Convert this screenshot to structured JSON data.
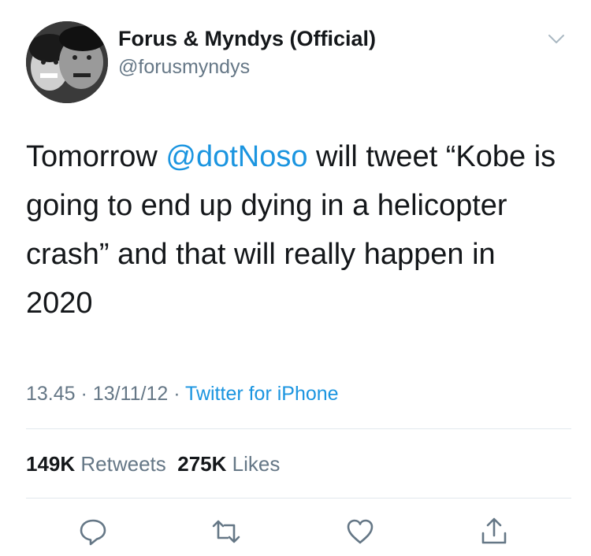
{
  "tweet": {
    "author_name": "Forus & Myndys (Official)",
    "author_handle": "@forusmyndys",
    "text_before": "Tomorrow ",
    "mention": "@dotNoso",
    "text_after": " will tweet “Kobe is going to end up dying in a helicopter crash” and that will really happen in 2020",
    "time": "13.45",
    "date": "13/11/12",
    "separator": "·",
    "source": "Twitter for iPhone",
    "retweets_count": "149K",
    "retweets_label": "Retweets",
    "likes_count": "275K",
    "likes_label": "Likes"
  },
  "icons": {
    "menu": "chevron-down-icon",
    "reply": "reply-icon",
    "retweet": "retweet-icon",
    "like": "heart-icon",
    "share": "share-icon"
  },
  "colors": {
    "text": "#14171a",
    "secondary": "#657786",
    "link": "#1b95e0",
    "divider": "#e1e8ed"
  }
}
